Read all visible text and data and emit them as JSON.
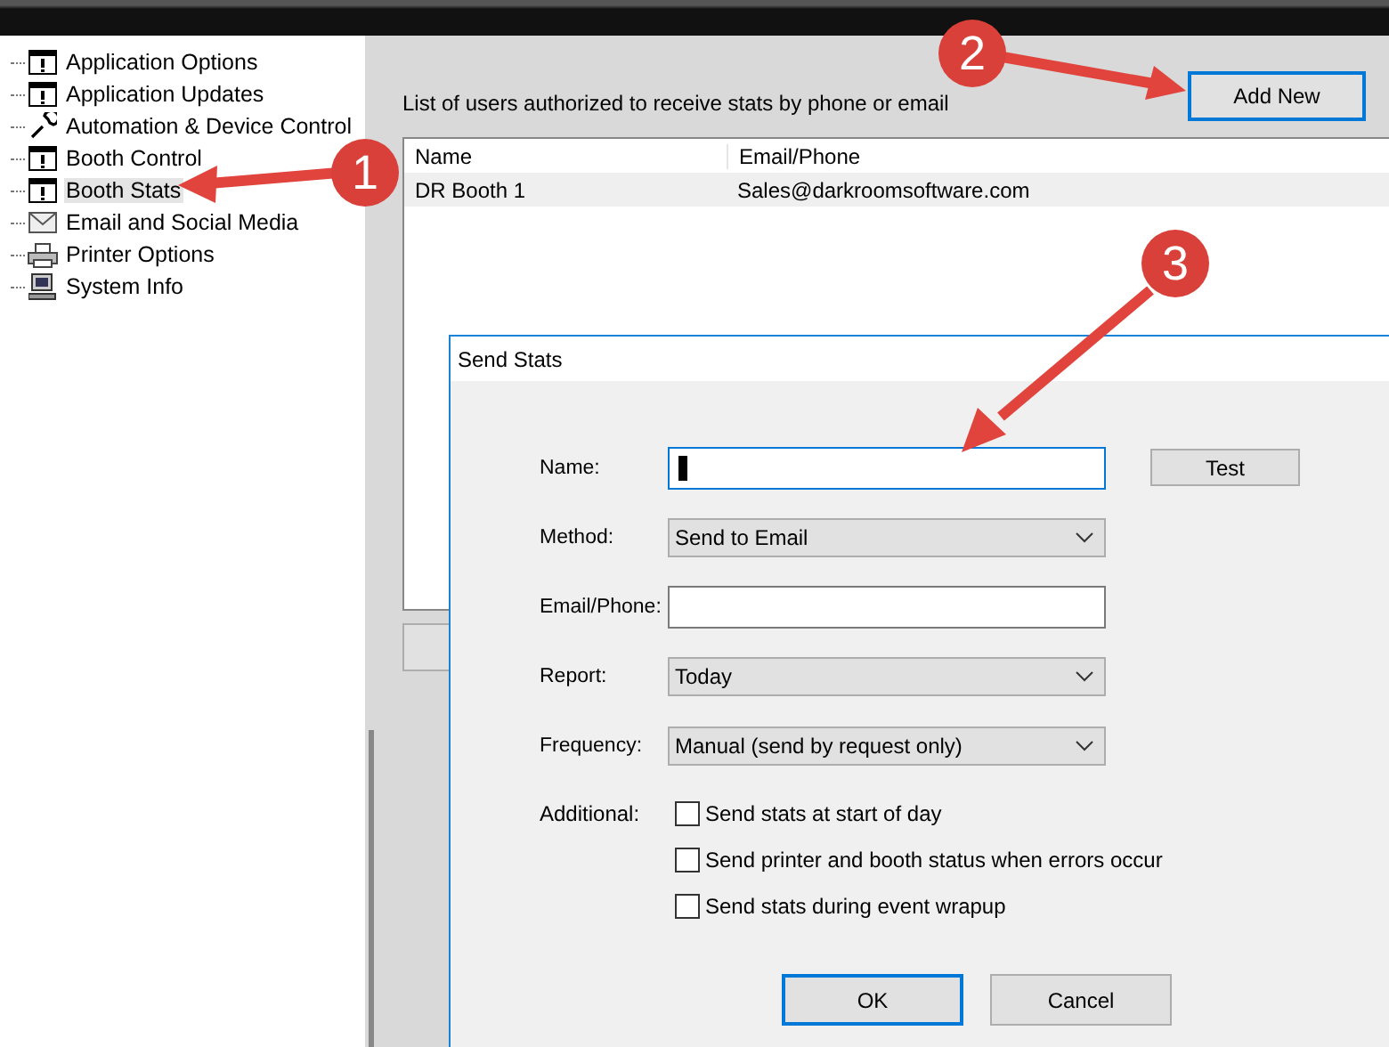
{
  "tree": {
    "items": [
      {
        "label": "Application Options",
        "kind": "window",
        "selected": false
      },
      {
        "label": "Application Updates",
        "kind": "window",
        "selected": false
      },
      {
        "label": "Automation & Device Control",
        "kind": "wrench",
        "selected": false
      },
      {
        "label": "Booth Control",
        "kind": "window",
        "selected": false
      },
      {
        "label": "Booth Stats",
        "kind": "window",
        "selected": true
      },
      {
        "label": "Email and Social Media",
        "kind": "mail",
        "selected": false
      },
      {
        "label": "Printer Options",
        "kind": "printer",
        "selected": false
      },
      {
        "label": "System Info",
        "kind": "computer",
        "selected": false
      }
    ]
  },
  "panel": {
    "description": "List of users authorized to receive stats by phone or email",
    "add_button": "Add New",
    "table": {
      "columns": [
        "Name",
        "Email/Phone"
      ],
      "rows": [
        {
          "cells": [
            "DR Booth 1",
            "Sales@darkroomsoftware.com"
          ],
          "selected": true
        }
      ]
    }
  },
  "dialog": {
    "title": "Send Stats",
    "fields": [
      {
        "kind": "text",
        "label": "Name:",
        "focused": true
      },
      {
        "kind": "select",
        "label": "Method:",
        "value": "Send to Email"
      },
      {
        "kind": "text",
        "label": "Email/Phone:",
        "focused": false
      },
      {
        "kind": "select",
        "label": "Report:",
        "value": "Today"
      },
      {
        "kind": "select",
        "label": "Frequency:",
        "value": "Manual (send by request only)"
      }
    ],
    "test_button": "Test",
    "additional_label": "Additional:",
    "options": [
      {
        "label": "Send stats at start of day",
        "checked": false
      },
      {
        "label": "Send printer and booth status when errors occur",
        "checked": false
      },
      {
        "label": "Send stats during event wrapup",
        "checked": false
      }
    ],
    "buttons": [
      "OK",
      "Cancel"
    ]
  },
  "callouts": [
    "1",
    "2",
    "3"
  ]
}
